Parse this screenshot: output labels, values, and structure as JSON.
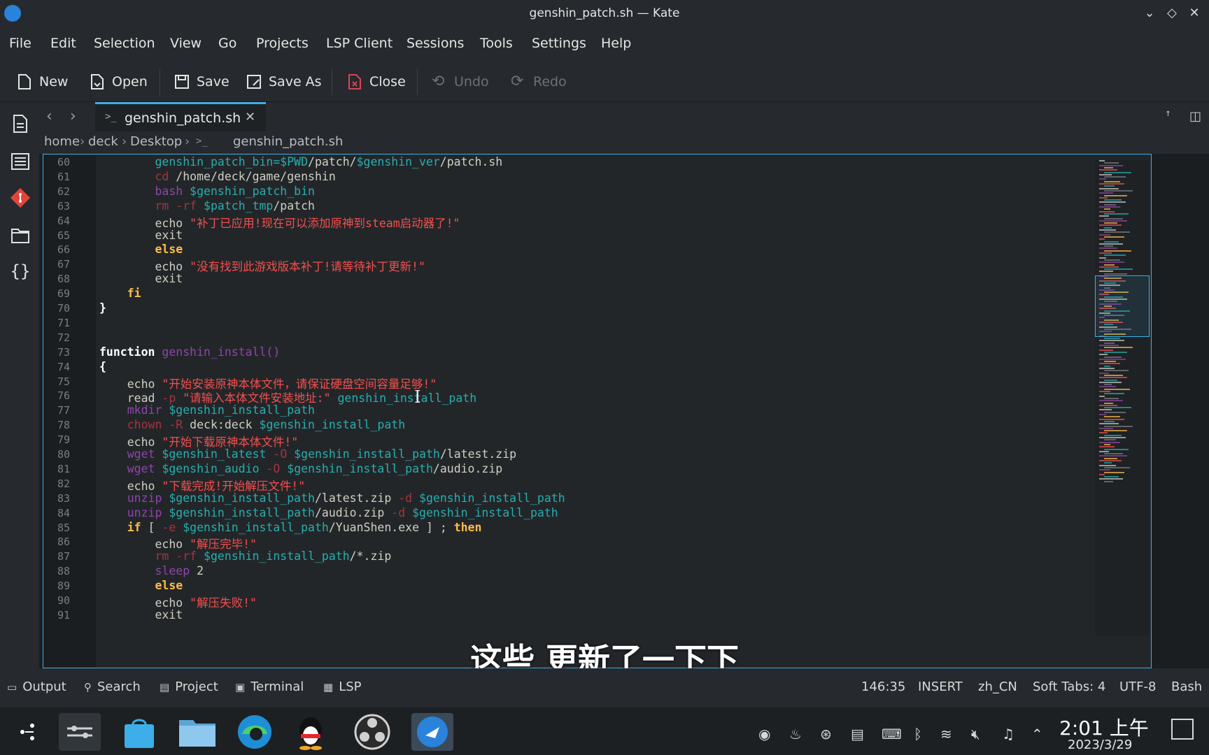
{
  "window": {
    "title": "genshin_patch.sh — Kate"
  },
  "menu": [
    "File",
    "Edit",
    "Selection",
    "View",
    "Go",
    "Projects",
    "LSP Client",
    "Sessions",
    "Tools",
    "Settings",
    "Help"
  ],
  "toolbar": {
    "new": "New",
    "open": "Open",
    "save": "Save",
    "save_as": "Save As",
    "close": "Close",
    "undo": "Undo",
    "redo": "Redo"
  },
  "tab": {
    "label": "genshin_patch.sh"
  },
  "breadcrumb": [
    "home",
    "deck",
    "Desktop",
    "genshin_patch.sh"
  ],
  "code_lines": [
    {
      "n": "60",
      "parts": [
        [
          "plain",
          "        "
        ],
        [
          "var",
          "genshin_patch_bin=$PWD"
        ],
        [
          "plain",
          "/patch/"
        ],
        [
          "var",
          "$genshin_ver"
        ],
        [
          "plain",
          "/patch.sh"
        ]
      ]
    },
    {
      "n": "61",
      "parts": [
        [
          "plain",
          "        "
        ],
        [
          "cmd",
          "cd"
        ],
        [
          "plain",
          " /home/deck/game/genshin"
        ]
      ]
    },
    {
      "n": "62",
      "parts": [
        [
          "plain",
          "        "
        ],
        [
          "fn",
          "bash"
        ],
        [
          "plain",
          " "
        ],
        [
          "var",
          "$genshin_patch_bin"
        ]
      ]
    },
    {
      "n": "63",
      "parts": [
        [
          "plain",
          "        "
        ],
        [
          "cmd",
          "rm -rf"
        ],
        [
          "plain",
          " "
        ],
        [
          "var",
          "$patch_tmp"
        ],
        [
          "plain",
          "/patch"
        ]
      ]
    },
    {
      "n": "64",
      "parts": [
        [
          "plain",
          "        echo "
        ],
        [
          "str",
          "\"补丁已应用!现在可以添加原神到steam启动器了!\""
        ]
      ]
    },
    {
      "n": "65",
      "parts": [
        [
          "plain",
          "        exit"
        ]
      ]
    },
    {
      "n": "66",
      "parts": [
        [
          "plain",
          "        "
        ],
        [
          "kw",
          "else"
        ]
      ]
    },
    {
      "n": "67",
      "parts": [
        [
          "plain",
          "        echo "
        ],
        [
          "str",
          "\"没有找到此游戏版本补丁!请等待补丁更新!\""
        ]
      ]
    },
    {
      "n": "68",
      "parts": [
        [
          "plain",
          "        exit"
        ]
      ]
    },
    {
      "n": "69",
      "parts": [
        [
          "plain",
          "    "
        ],
        [
          "kw",
          "fi"
        ]
      ]
    },
    {
      "n": "70",
      "parts": [
        [
          "bold",
          "}"
        ]
      ]
    },
    {
      "n": "71",
      "parts": []
    },
    {
      "n": "72",
      "parts": []
    },
    {
      "n": "73",
      "parts": [
        [
          "bold",
          "function"
        ],
        [
          "plain",
          " "
        ],
        [
          "fn",
          "genshin_install()"
        ]
      ]
    },
    {
      "n": "74",
      "parts": [
        [
          "bold",
          "{"
        ]
      ]
    },
    {
      "n": "75",
      "parts": [
        [
          "plain",
          "    echo "
        ],
        [
          "str",
          "\"开始安装原神本体文件，请保证硬盘空间容量足够!\""
        ]
      ]
    },
    {
      "n": "76",
      "parts": [
        [
          "plain",
          "    read "
        ],
        [
          "cmd",
          "-p"
        ],
        [
          "plain",
          " "
        ],
        [
          "str",
          "\"请输入本体文件安装地址:\""
        ],
        [
          "plain",
          " "
        ],
        [
          "var",
          "genshin_install_path"
        ]
      ]
    },
    {
      "n": "77",
      "parts": [
        [
          "plain",
          "    "
        ],
        [
          "fn",
          "mkdir"
        ],
        [
          "plain",
          " "
        ],
        [
          "var",
          "$genshin_install_path"
        ]
      ]
    },
    {
      "n": "78",
      "parts": [
        [
          "plain",
          "    "
        ],
        [
          "cmd",
          "chown -R"
        ],
        [
          "plain",
          " deck:deck "
        ],
        [
          "var",
          "$genshin_install_path"
        ]
      ]
    },
    {
      "n": "79",
      "parts": [
        [
          "plain",
          "    echo "
        ],
        [
          "str",
          "\"开始下载原神本体文件!\""
        ]
      ]
    },
    {
      "n": "80",
      "parts": [
        [
          "plain",
          "    "
        ],
        [
          "fn",
          "wget"
        ],
        [
          "plain",
          " "
        ],
        [
          "var",
          "$genshin_latest"
        ],
        [
          "plain",
          " "
        ],
        [
          "cmd",
          "-O"
        ],
        [
          "plain",
          " "
        ],
        [
          "var",
          "$genshin_install_path"
        ],
        [
          "plain",
          "/latest.zip"
        ]
      ]
    },
    {
      "n": "81",
      "parts": [
        [
          "plain",
          "    "
        ],
        [
          "fn",
          "wget"
        ],
        [
          "plain",
          " "
        ],
        [
          "var",
          "$genshin_audio"
        ],
        [
          "plain",
          " "
        ],
        [
          "cmd",
          "-O"
        ],
        [
          "plain",
          " "
        ],
        [
          "var",
          "$genshin_install_path"
        ],
        [
          "plain",
          "/audio.zip"
        ]
      ]
    },
    {
      "n": "82",
      "parts": [
        [
          "plain",
          "    echo "
        ],
        [
          "str",
          "\"下载完成!开始解压文件!\""
        ]
      ]
    },
    {
      "n": "83",
      "parts": [
        [
          "plain",
          "    "
        ],
        [
          "fn",
          "unzip"
        ],
        [
          "plain",
          " "
        ],
        [
          "var",
          "$genshin_install_path"
        ],
        [
          "plain",
          "/latest.zip "
        ],
        [
          "cmd",
          "-d"
        ],
        [
          "plain",
          " "
        ],
        [
          "var",
          "$genshin_install_path"
        ]
      ]
    },
    {
      "n": "84",
      "parts": [
        [
          "plain",
          "    "
        ],
        [
          "fn",
          "unzip"
        ],
        [
          "plain",
          " "
        ],
        [
          "var",
          "$genshin_install_path"
        ],
        [
          "plain",
          "/audio.zip "
        ],
        [
          "cmd",
          "-d"
        ],
        [
          "plain",
          " "
        ],
        [
          "var",
          "$genshin_install_path"
        ]
      ]
    },
    {
      "n": "85",
      "parts": [
        [
          "plain",
          "    "
        ],
        [
          "kw",
          "if"
        ],
        [
          "plain",
          " [ "
        ],
        [
          "cmd",
          "-e"
        ],
        [
          "plain",
          " "
        ],
        [
          "var",
          "$genshin_install_path"
        ],
        [
          "plain",
          "/YuanShen.exe ] ; "
        ],
        [
          "kw",
          "then"
        ]
      ]
    },
    {
      "n": "86",
      "parts": [
        [
          "plain",
          "        echo "
        ],
        [
          "str",
          "\"解压完毕!\""
        ]
      ]
    },
    {
      "n": "87",
      "parts": [
        [
          "plain",
          "        "
        ],
        [
          "cmd",
          "rm -rf"
        ],
        [
          "plain",
          " "
        ],
        [
          "var",
          "$genshin_install_path"
        ],
        [
          "plain",
          "/*.zip"
        ]
      ]
    },
    {
      "n": "88",
      "parts": [
        [
          "plain",
          "        "
        ],
        [
          "fn",
          "sleep"
        ],
        [
          "plain",
          " 2"
        ]
      ]
    },
    {
      "n": "89",
      "parts": [
        [
          "plain",
          "        "
        ],
        [
          "kw",
          "else"
        ]
      ]
    },
    {
      "n": "90",
      "parts": [
        [
          "plain",
          "        echo "
        ],
        [
          "str",
          "\"解压失败!\""
        ]
      ]
    },
    {
      "n": "91",
      "parts": [
        [
          "plain",
          "        exit"
        ]
      ]
    }
  ],
  "subtitle": "这些 更新了一下下",
  "statusbar": {
    "output": "Output",
    "search": "Search",
    "project": "Project",
    "terminal": "Terminal",
    "lsp": "LSP",
    "position": "146:35",
    "mode": "INSERT",
    "language": "zh_CN",
    "indent": "Soft Tabs: 4",
    "encoding": "UTF-8",
    "syntax": "Bash"
  },
  "clock": {
    "time": "2:01 上午",
    "date": "2023/3/29"
  },
  "colors": {
    "accent": "#3daee9",
    "string": "#f44f4f",
    "keyword": "#fdbc4b",
    "variable": "#27aeae",
    "function": "#8e44ad"
  }
}
